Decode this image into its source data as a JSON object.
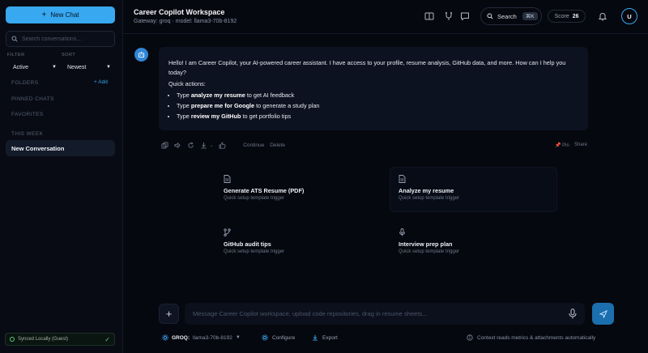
{
  "sidebar": {
    "new_chat": "New Chat",
    "search_placeholder": "Search conversations...",
    "filter_label": "FILTER",
    "sort_label": "SORT",
    "filter_value": "Active",
    "sort_value": "Newest",
    "folders_label": "FOLDERS",
    "add_label": "+ Add",
    "pinned_label": "PINNED CHATS",
    "favorites_label": "FAVORITES",
    "this_week_label": "THIS WEEK",
    "conversations": [
      "New Conversation"
    ],
    "sync_status": "Synced Locally (Guest)"
  },
  "header": {
    "title": "Career Copilot Workspace",
    "subtitle": "Gateway: groq · model: llama3-70b-8192",
    "search_label": "Search",
    "search_shortcut": "⌘K",
    "score_label": "Score",
    "score_value": "26",
    "avatar_initial": "U"
  },
  "message": {
    "greeting": "Hello! I am Career Copilot, your AI-powered career assistant. I have access to your profile, resume analysis, GitHub data, and more. How can I help you today?",
    "quick_actions_label": "Quick actions:",
    "actions": [
      {
        "pre": "Type ",
        "cmd": "analyze my resume",
        "post": " to get AI feedback"
      },
      {
        "pre": "Type ",
        "cmd": "prepare me for Google",
        "post": " to generate a study plan"
      },
      {
        "pre": "Type ",
        "cmd": "review my GitHub",
        "post": " to get portfolio tips"
      }
    ],
    "continue_label": "Continue",
    "delete_label": "Delete",
    "pin_label": "Pin",
    "share_label": "Share"
  },
  "templates": [
    {
      "title": "Generate ATS Resume (PDF)",
      "subtitle": "Quick setup template trigger",
      "icon": "document-icon"
    },
    {
      "title": "Analyze my resume",
      "subtitle": "Quick setup template trigger",
      "icon": "document-icon"
    },
    {
      "title": "GitHub audit tips",
      "subtitle": "Quick setup template trigger",
      "icon": "git-branch-icon"
    },
    {
      "title": "Interview prep plan",
      "subtitle": "Quick setup template trigger",
      "icon": "microphone-icon"
    }
  ],
  "composer": {
    "placeholder": "Message Career Copilot workspace, upload code repositories, drag in resume sheets..."
  },
  "footer": {
    "provider": "GROQ:",
    "model": "llama3-70b-8192",
    "configure": "Configure",
    "export": "Export",
    "hint": "Context reads metrics & attachments automatically"
  },
  "colors": {
    "accent": "#38a8f0",
    "background": "#06080f",
    "panel": "#0d1220"
  }
}
